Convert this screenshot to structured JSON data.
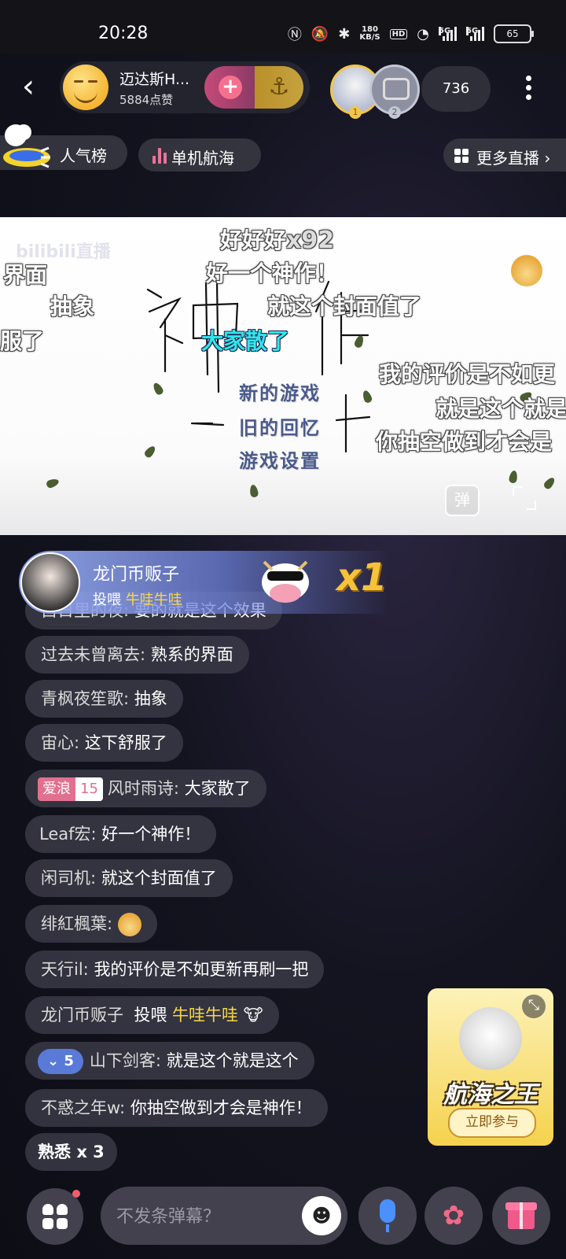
{
  "status_bar": {
    "time": "20:28",
    "net_speed_value": "180",
    "net_speed_unit": "KB/S",
    "hd_label": "HD",
    "net_5g_1": "5G",
    "net_5g_2": "5G",
    "battery": "65"
  },
  "header": {
    "host_name": "迈达斯H...",
    "host_likes": "5884点赞",
    "viewer_count": "736",
    "rank_1_badge": "1",
    "rank_2_badge": "2"
  },
  "tags": {
    "hot_rank": "人气榜",
    "game_tag": "单机航海",
    "more_live": "更多直播"
  },
  "video": {
    "watermark": "bilibili直播",
    "danmaku_toggle": "弹",
    "menu_items": [
      "新的游戏",
      "旧的回忆",
      "游戏设置"
    ],
    "danmaku": {
      "d1": "好好好",
      "d1_count": "x92",
      "d2": "好一个神作！",
      "d3": "界面",
      "d4": "抽象",
      "d5": "就这个封面值了",
      "d6": "大家散了",
      "d7": "服了",
      "d8": "我的评价是不如更",
      "d9": "就是这个就是",
      "d10": "你抽空做到才会是"
    }
  },
  "gift_banner": {
    "sender": "龙门币贩子",
    "action": "投喂",
    "item": "牛哇牛哇",
    "multiplier": "x1"
  },
  "chat": [
    {
      "user": "白日里的夜:",
      "text": "要的就是这个效果"
    },
    {
      "user": "过去未曾离去:",
      "text": "熟系的界面"
    },
    {
      "user": "青枫夜笙歌:",
      "text": "抽象"
    },
    {
      "user": "宙心:",
      "text": "这下舒服了"
    },
    {
      "user": "风时雨诗:",
      "text": "大家散了",
      "badge_name": "爱浪",
      "badge_level": "15"
    },
    {
      "user": "Leaf宏:",
      "text": "好一个神作！"
    },
    {
      "user": "闲司机:",
      "text": "就这个封面值了"
    },
    {
      "user": "绯紅楓葉:",
      "text": ""
    },
    {
      "user": "天行il:",
      "text": "我的评价是不如更新再刷一把"
    },
    {
      "user": "龙门币贩子",
      "text": "投喂",
      "gift": "牛哇牛哇"
    },
    {
      "user": "山下剑客:",
      "text": "就是这个就是这个",
      "guard_level": "5"
    },
    {
      "user": "不惑之年w:",
      "text": "你抽空做到才会是神作！"
    },
    {
      "user": "熟悉",
      "text": "x 3"
    }
  ],
  "promo": {
    "title": "航海之王",
    "button": "立即参与"
  },
  "bottom_bar": {
    "input_placeholder": "不发条弹幕？"
  }
}
